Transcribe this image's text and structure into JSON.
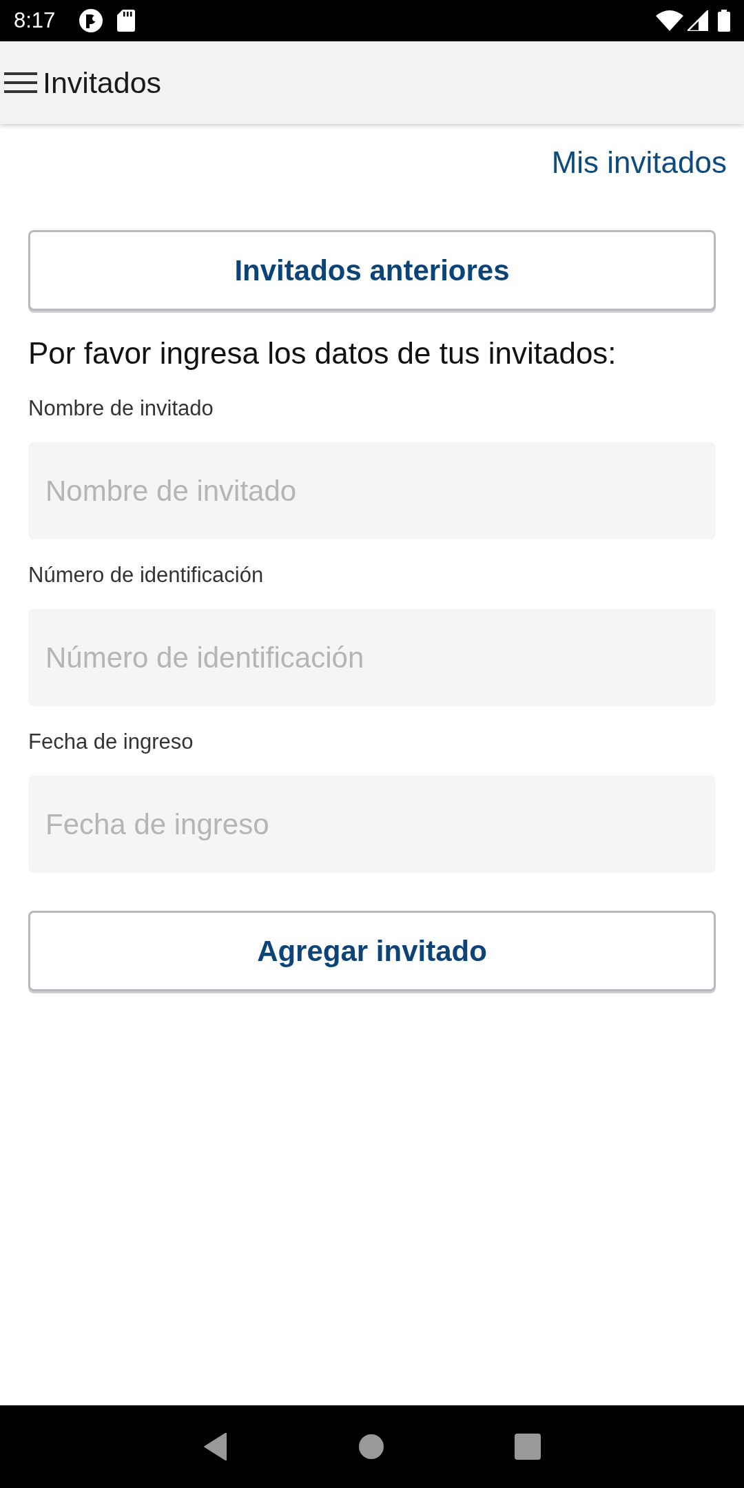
{
  "status_bar": {
    "time": "8:17"
  },
  "app_bar": {
    "title": "Invitados"
  },
  "link": "Mis invitados",
  "previous_button": "Invitados anteriores",
  "prompt": "Por favor ingresa los datos de tus invitados:",
  "fields": [
    {
      "label": "Nombre de invitado",
      "placeholder": "Nombre de invitado"
    },
    {
      "label": "Número de identificación",
      "placeholder": "Número de identificación"
    },
    {
      "label": "Fecha de ingreso",
      "placeholder": "Fecha de ingreso"
    }
  ],
  "add_button": "Agregar invitado"
}
